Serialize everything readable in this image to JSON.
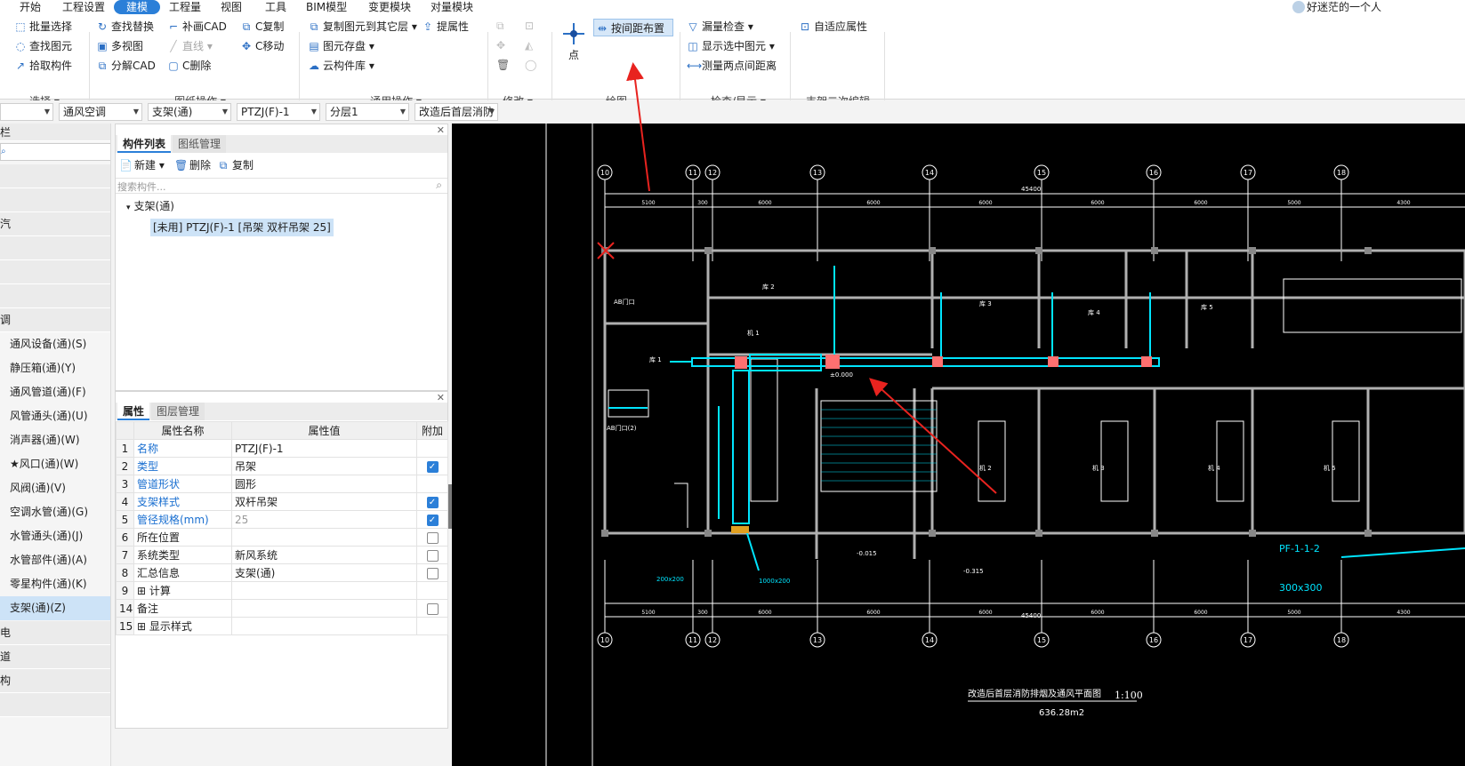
{
  "menu": {
    "items": [
      "开始",
      "工程设置",
      "建模",
      "工程量",
      "视图",
      "工具",
      "BIM模型",
      "变更模块",
      "对量模块"
    ],
    "active": "建模",
    "user": "好迷茫的一个人"
  },
  "ribbon": {
    "select": {
      "items": [
        "批量选择",
        "查找图元",
        "拾取构件"
      ],
      "label": "选择"
    },
    "drawing_ops": {
      "items": [
        "查找替换",
        "多视图",
        "分解CAD",
        "补画CAD",
        "直线",
        "C删除",
        "C复制",
        "C移动"
      ],
      "label": "图纸操作"
    },
    "general_ops": {
      "items": [
        "复制图元到其它层",
        "图元存盘",
        "云构件库",
        "提属性"
      ],
      "label": "通用操作"
    },
    "modify": {
      "label": "修改"
    },
    "draw": {
      "point": "点",
      "spacing": "按间距布置",
      "label": "绘图"
    },
    "check": {
      "items": [
        "漏量检查",
        "显示选中图元",
        "测量两点间距离"
      ],
      "label": "检查/显示"
    },
    "support_edit": {
      "items": [
        "自适应属性"
      ],
      "label": "支架二次编辑"
    }
  },
  "filters": [
    "通风空调",
    "支架(通)",
    "PTZJ(F)-1",
    "分层1",
    "改造后首层消防"
  ],
  "nav": {
    "partial_header": "栏",
    "items": [
      "汽",
      "调",
      "通风设备(通)(S)",
      "静压箱(通)(Y)",
      "通风管道(通)(F)",
      "风管通头(通)(U)",
      "消声器(通)(W)",
      "★风口(通)(W)",
      "风阀(通)(V)",
      "空调水管(通)(G)",
      "水管通头(通)(J)",
      "水管部件(通)(A)",
      "零星构件(通)(K)",
      "支架(通)(Z)",
      "电",
      "道",
      "构"
    ],
    "selected": "支架(通)(Z)"
  },
  "component_panel": {
    "tabs": [
      "构件列表",
      "图纸管理"
    ],
    "new": "新建",
    "delete": "删除",
    "copy": "复制",
    "search_placeholder": "搜索构件...",
    "tree_root": "支架(通)",
    "tree_item": "[未用] PTZJ(F)-1 [吊架 双杆吊架 25]"
  },
  "props_panel": {
    "tabs": [
      "属性",
      "图层管理"
    ],
    "headers": [
      "属性名称",
      "属性值",
      "附加"
    ],
    "rows": [
      {
        "n": "1",
        "name": "名称",
        "value": "PTZJ(F)-1",
        "blue": true,
        "check": ""
      },
      {
        "n": "2",
        "name": "类型",
        "value": "吊架",
        "blue": true,
        "check": "on"
      },
      {
        "n": "3",
        "name": "管道形状",
        "value": "圆形",
        "blue": true,
        "check": ""
      },
      {
        "n": "4",
        "name": "支架样式",
        "value": "双杆吊架",
        "blue": true,
        "check": "on"
      },
      {
        "n": "5",
        "name": "管径规格(mm)",
        "value": "25",
        "blue": true,
        "check": "on",
        "gray": true
      },
      {
        "n": "6",
        "name": "所在位置",
        "value": "",
        "blue": false,
        "check": "off"
      },
      {
        "n": "7",
        "name": "系统类型",
        "value": "新风系统",
        "blue": false,
        "check": "off"
      },
      {
        "n": "8",
        "name": "汇总信息",
        "value": "支架(通)",
        "blue": false,
        "check": "off"
      },
      {
        "n": "9",
        "name": "⊞ 计算",
        "value": "",
        "blue": false,
        "check": ""
      },
      {
        "n": "14",
        "name": "备注",
        "value": "",
        "blue": false,
        "check": "off"
      },
      {
        "n": "15",
        "name": "⊞ 显示样式",
        "value": "",
        "blue": false,
        "check": ""
      }
    ]
  },
  "cad": {
    "axis_labels": [
      "10",
      "11",
      "12",
      "13",
      "14",
      "15",
      "16",
      "17",
      "18"
    ],
    "top_total": "45400",
    "dims": [
      "5100",
      "300",
      "6000",
      "6000",
      "6000",
      "6000",
      "6000",
      "5000",
      "4300"
    ],
    "rooms": [
      "库 1",
      "库 2",
      "库 3",
      "库 4",
      "库 5",
      "机 1",
      "机 2",
      "机 3",
      "机 4",
      "机 5",
      "AB门口",
      "AB门口(2)"
    ],
    "title": "改造后首层消防排烟及通风平面图",
    "scale": "1:100",
    "area": "636.28m2",
    "pf_label": "PF-1-1-2",
    "duct_sizes": [
      "200x200",
      "1000x200",
      "300x300"
    ],
    "levels": [
      "±0.000",
      "-0.015",
      "-0.315"
    ]
  },
  "colors": {
    "accent": "#2b7fd8",
    "cad_bg": "#000000",
    "duct": "#00e5ff",
    "arrow": "#e8231f"
  }
}
